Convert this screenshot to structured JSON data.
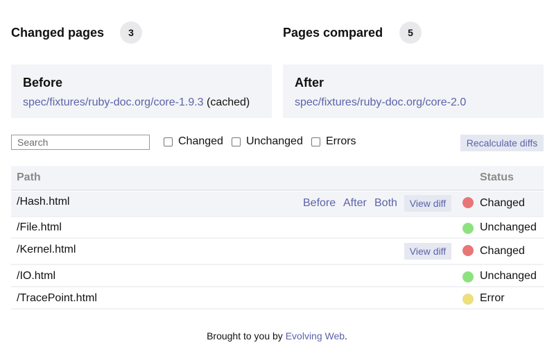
{
  "stats": {
    "changed_label": "Changed pages",
    "changed_count": "3",
    "compared_label": "Pages compared",
    "compared_count": "5"
  },
  "before": {
    "title": "Before",
    "path": "spec/fixtures/ruby-doc.org/core-1.9.3",
    "note": " (cached)"
  },
  "after": {
    "title": "After",
    "path": "spec/fixtures/ruby-doc.org/core-2.0"
  },
  "filters": {
    "search_placeholder": "Search",
    "changed_label": "Changed",
    "unchanged_label": "Unchanged",
    "errors_label": "Errors",
    "recalculate_label": "Recalculate diffs"
  },
  "table": {
    "header_path": "Path",
    "header_status": "Status",
    "link_before": "Before",
    "link_after": "After",
    "link_both": "Both",
    "view_diff": "View diff",
    "rows": [
      {
        "path": "/Hash.html",
        "status": "Changed"
      },
      {
        "path": "/File.html",
        "status": "Unchanged"
      },
      {
        "path": "/Kernel.html",
        "status": "Changed"
      },
      {
        "path": "/IO.html",
        "status": "Unchanged"
      },
      {
        "path": "/TracePoint.html",
        "status": "Error"
      }
    ]
  },
  "status_colors": {
    "changed": "#e87676",
    "unchanged": "#8de27f",
    "error": "#ecdf7e"
  },
  "footer": {
    "prefix": "Brought to you by ",
    "link": "Evolving Web",
    "suffix": "."
  }
}
